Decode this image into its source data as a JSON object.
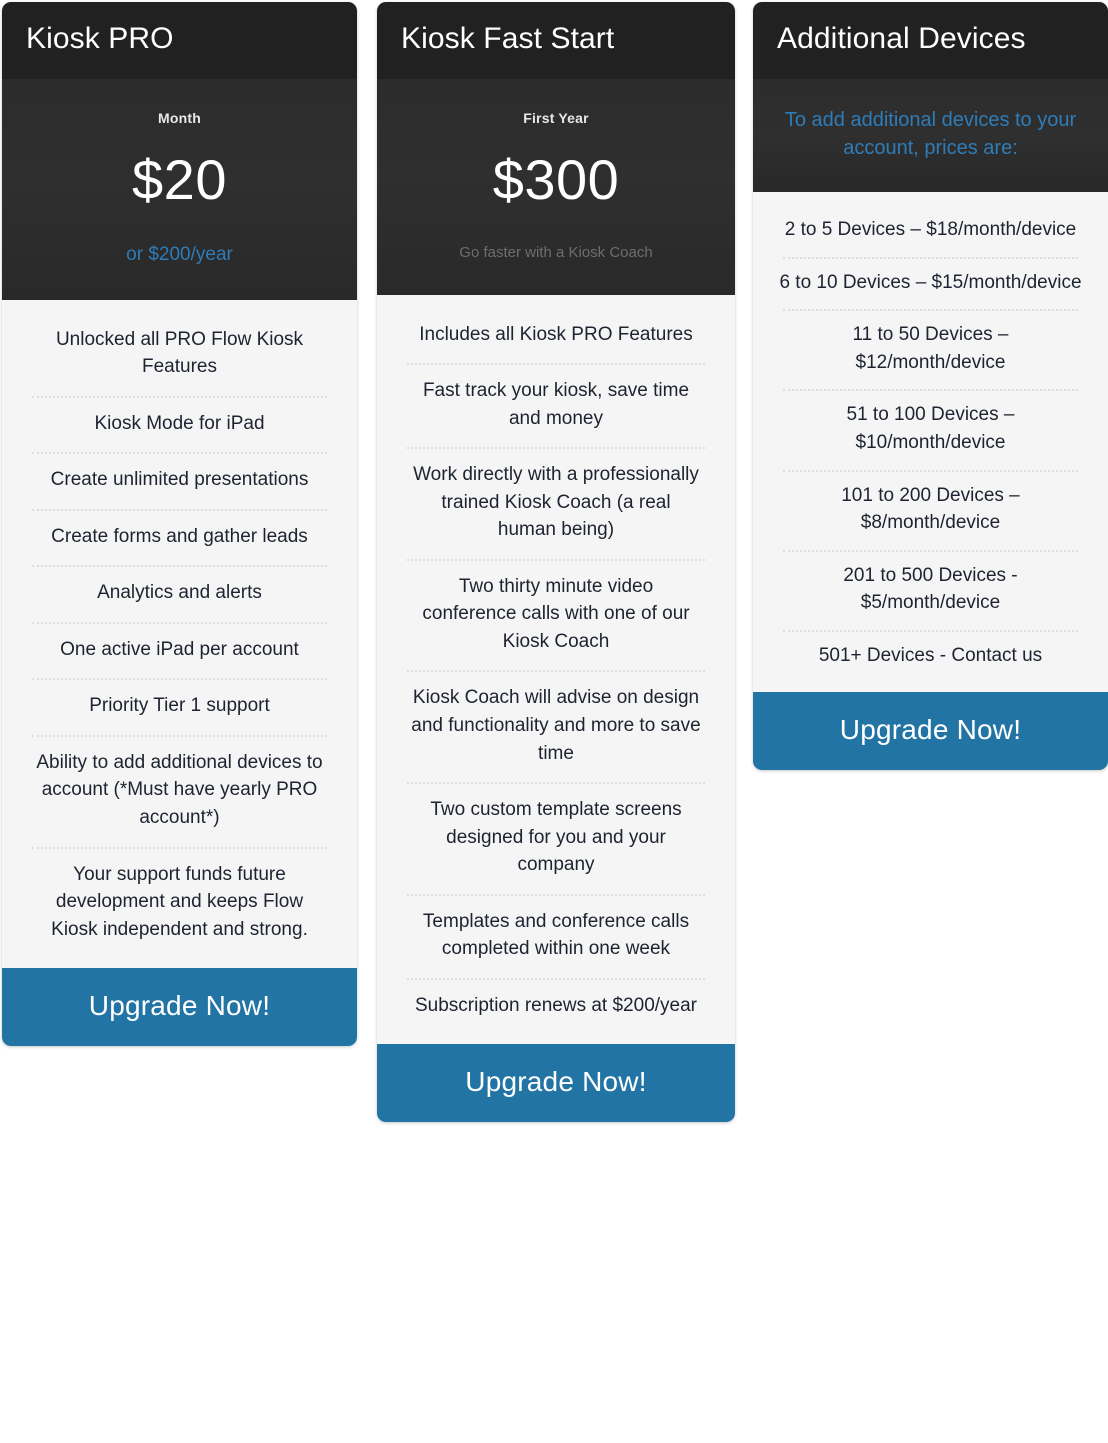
{
  "accent_blue": "#2274a5",
  "link_blue": "#2e7cb8",
  "header_dark": "#212121",
  "panel_dark": "#2d2d2d",
  "body_gray": "#f5f5f5",
  "plans": [
    {
      "id": "kiosk-pro",
      "title": "Kiosk PRO",
      "period": "Month",
      "amount": "$20",
      "note": "or $200/year",
      "note_style": "accent",
      "features": [
        "Unlocked all PRO Flow Kiosk Features",
        "Kiosk Mode for iPad",
        "Create unlimited presentations",
        "Create forms and gather leads",
        "Analytics and alerts",
        "One active iPad per account",
        "Priority Tier 1 support",
        "Ability to add additional devices to account (*Must have yearly PRO account*)",
        "Your support funds future development and keeps Flow Kiosk independent and strong."
      ],
      "cta_label": "Upgrade Now!"
    },
    {
      "id": "kiosk-fast-start",
      "title": "Kiosk Fast Start",
      "period": "First Year",
      "amount": "$300",
      "note": "Go faster with a Kiosk Coach",
      "note_style": "muted",
      "features": [
        "Includes all Kiosk PRO Features",
        "Fast track your kiosk, save time and money",
        "Work directly with a professionally trained Kiosk Coach (a real human being)",
        "Two thirty minute video conference calls with one of our Kiosk Coach",
        "Kiosk Coach will advise on design and functionality and more to save time",
        "Two custom template screens designed for you and your company",
        "Templates and conference calls completed within one week",
        "Subscription renews at $200/year"
      ],
      "cta_label": "Upgrade Now!"
    },
    {
      "id": "additional-devices",
      "title": "Additional Devices",
      "blurb": "To add additional devices to your account, prices are:",
      "features": [
        "2 to 5 Devices – $18/month/device",
        "6 to 10 Devices – $15/month/device",
        "11 to 50 Devices – $12/month/device",
        "51 to 100 Devices – $10/month/device",
        "101 to 200 Devices – $8/month/device",
        "201 to 500 Devices - $5/month/device",
        "501+ Devices - Contact us"
      ],
      "cta_label": "Upgrade Now!"
    }
  ]
}
